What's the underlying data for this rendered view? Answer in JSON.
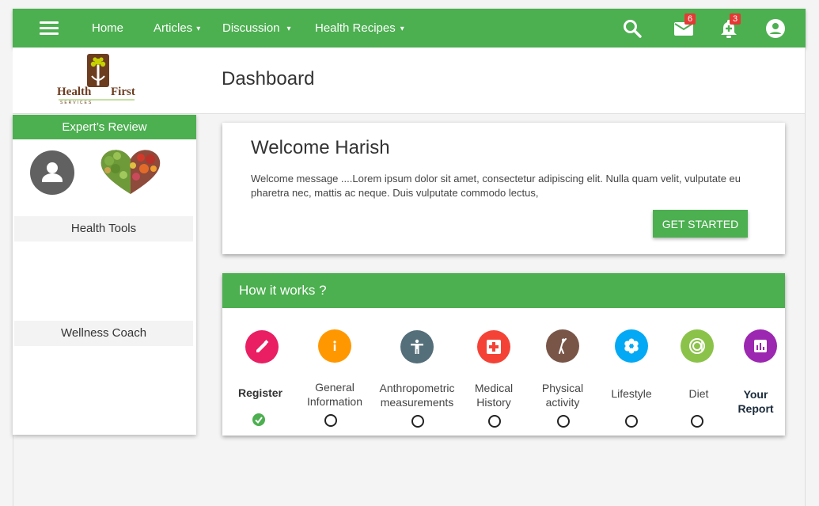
{
  "nav": {
    "home": "Home",
    "articles": "Articles",
    "discussion": "Discussion",
    "health_recipes": "Health Recipes",
    "caret": "▾",
    "mail_count": "6",
    "notification_count": "3"
  },
  "brand": {
    "logo_word_left": "Health",
    "logo_word_right": "First",
    "logo_sub": "SERVICES"
  },
  "page": {
    "title": "Dashboard"
  },
  "sidebar": {
    "expert_review": "Expert’s Review",
    "health_tools": "Health Tools",
    "wellness_coach": "Wellness Coach"
  },
  "welcome": {
    "title": "Welcome Harish",
    "message": "Welcome message ....Lorem ipsum dolor sit amet, consectetur adipiscing elit. Nulla quam velit, vulputate eu pharetra nec, mattis ac neque. Duis vulputate commodo lectus,",
    "button": "GET STARTED"
  },
  "how_it_works": {
    "title": "How it works ?",
    "steps": [
      {
        "line1": "Register",
        "line2": "",
        "color": "#e91e63",
        "icon": "pencil-icon",
        "done": true
      },
      {
        "line1": "General",
        "line2": "Information",
        "color": "#ff9800",
        "icon": "info-icon",
        "done": false
      },
      {
        "line1": "Anthropometric",
        "line2": "measurements",
        "color": "#546e7a",
        "icon": "body-icon",
        "done": false
      },
      {
        "line1": "Medical",
        "line2": "History",
        "color": "#f44336",
        "icon": "medical-cross-icon",
        "done": false
      },
      {
        "line1": "Physical",
        "line2": "activity",
        "color": "#795548",
        "icon": "exercise-icon",
        "done": false
      },
      {
        "line1": "Lifestyle",
        "line2": "",
        "color": "#03a9f4",
        "icon": "flower-icon",
        "done": false
      },
      {
        "line1": "Diet",
        "line2": "",
        "color": "#8bc34a",
        "icon": "plate-icon",
        "done": false
      },
      {
        "line1": "Your",
        "line2": "Report",
        "color": "#9c27b0",
        "icon": "report-icon",
        "done": false
      }
    ]
  },
  "colors": {
    "primary": "#4caf50",
    "badge": "#e53935"
  }
}
